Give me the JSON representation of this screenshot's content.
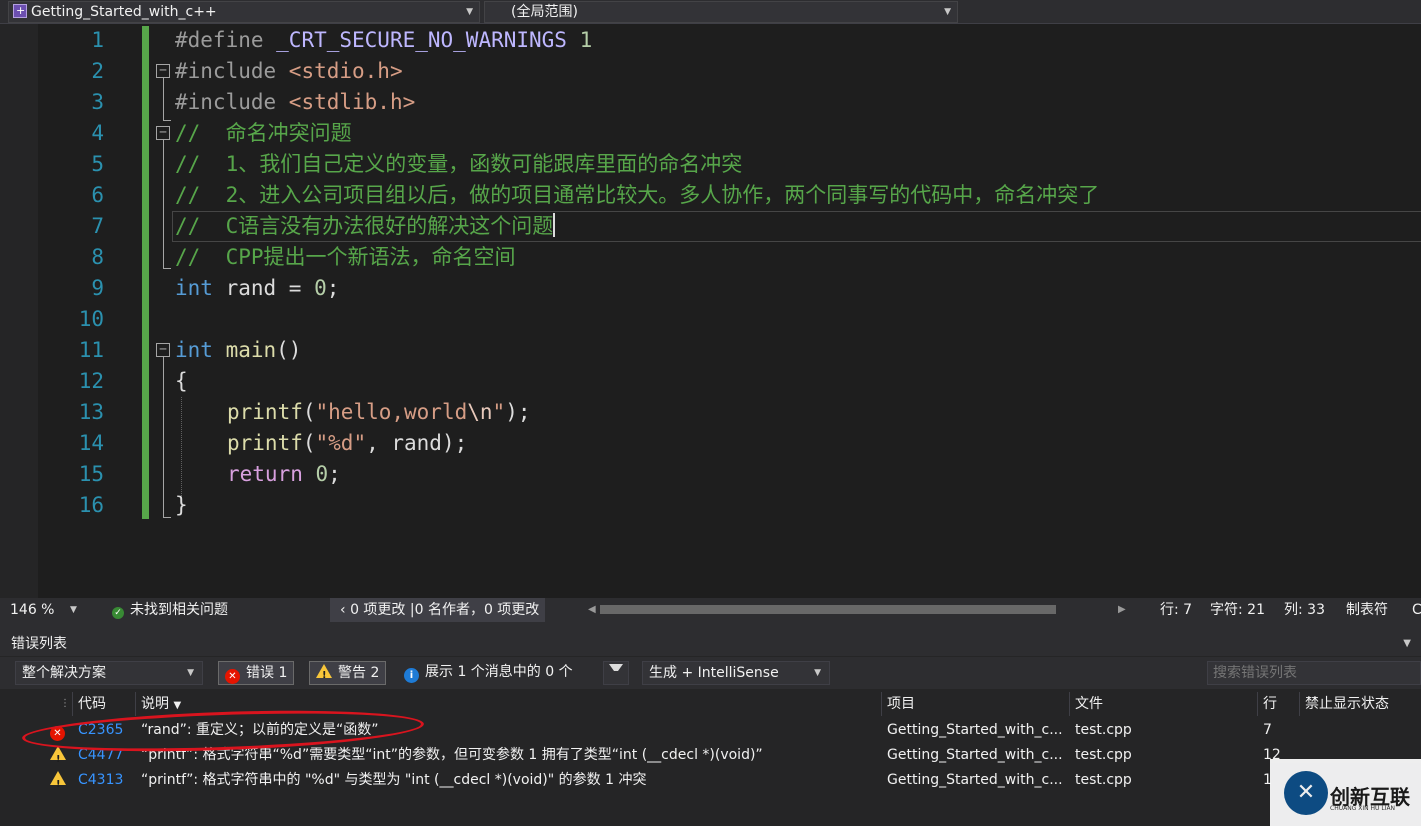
{
  "navbar": {
    "project": "Getting_Started_with_c++",
    "scope": "(全局范围)"
  },
  "code_lines": [
    {
      "n": "1"
    },
    {
      "n": "2"
    },
    {
      "n": "3"
    },
    {
      "n": "4"
    },
    {
      "n": "5"
    },
    {
      "n": "6"
    },
    {
      "n": "7"
    },
    {
      "n": "8"
    },
    {
      "n": "9"
    },
    {
      "n": "10"
    },
    {
      "n": "11"
    },
    {
      "n": "12"
    },
    {
      "n": "13"
    },
    {
      "n": "14"
    },
    {
      "n": "15"
    },
    {
      "n": "16"
    }
  ],
  "code": {
    "l1": {
      "a": "#define ",
      "b": "_CRT_SECURE_NO_WARNINGS",
      "c": " 1"
    },
    "l2": {
      "a": "#include ",
      "b": "<stdio.h>"
    },
    "l3": {
      "a": "#include ",
      "b": "<stdlib.h>"
    },
    "l4": "//  命名冲突问题",
    "l5": "//  1、我们自己定义的变量，函数可能跟库里面的命名冲突",
    "l6": "//  2、进入公司项目组以后，做的项目通常比较大。多人协作，两个同事写的代码中，命名冲突了",
    "l7": "//  C语言没有办法很好的解决这个问题",
    "l8": "//  CPP提出一个新语法，命名空间",
    "l9": {
      "kw": "int",
      "rest": " rand = ",
      "num": "0",
      "end": ";"
    },
    "l11": {
      "kw": "int",
      "fn": " main",
      "rest": "()"
    },
    "l12": "{",
    "l13": {
      "fn": "printf",
      "p1": "(",
      "s1": "\"hello,world",
      "esc": "\\n",
      "s2": "\"",
      "p2": ");"
    },
    "l14": {
      "fn": "printf",
      "p1": "(",
      "s": "\"%d\"",
      "p2": ", rand);"
    },
    "l15": {
      "ctl": "return",
      "sp": " ",
      "num": "0",
      "end": ";"
    },
    "l16": "}"
  },
  "editor_status": {
    "zoom": "146 %",
    "issues": "未找到相关问题",
    "changes": "0 项更改",
    "authors": "0 名作者，0 项更改",
    "line": "行: 7",
    "char": "字符: 21",
    "col": "列: 33",
    "tab": "制表符",
    "extra": "C"
  },
  "error_list": {
    "title": "错误列表",
    "scope": "整个解决方案",
    "errors_label": "错误 1",
    "warnings_label": "警告 2",
    "messages_label": "展示 1 个消息中的 0 个",
    "build_mode": "生成 + IntelliSense",
    "search_placeholder": "搜索错误列表",
    "columns": {
      "code": "代码",
      "desc": "说明",
      "project": "项目",
      "file": "文件",
      "line": "行",
      "suppress": "禁止显示状态"
    },
    "rows": [
      {
        "severity": "error",
        "code": "C2365",
        "desc": "“rand”: 重定义；以前的定义是“函数”",
        "project": "Getting_Started_with_c...",
        "file": "test.cpp",
        "line": "7"
      },
      {
        "severity": "warning",
        "code": "C4477",
        "desc": "“printf”: 格式字符串“%d”需要类型“int”的参数，但可变参数 1 拥有了类型“int (__cdecl *)(void)”",
        "project": "Getting_Started_with_c...",
        "file": "test.cpp",
        "line": "12"
      },
      {
        "severity": "warning",
        "code": "C4313",
        "desc": "“printf”: 格式字符串中的 \"%d\" 与类型为 \"int (__cdecl *)(void)\" 的参数 1 冲突",
        "project": "Getting_Started_with_c...",
        "file": "test.cpp",
        "line": "1"
      }
    ]
  },
  "watermark": {
    "logo": "创新互联",
    "sub": "CHUANG XIN HU LIAN"
  },
  "colors": {
    "keyword": "#569cd6",
    "comment": "#57a64a",
    "string": "#d69d85",
    "function": "#dcdcaa",
    "line_number": "#2b91af",
    "error": "#e51400",
    "warning": "#f8c63a",
    "annotation": "#d9141e"
  }
}
